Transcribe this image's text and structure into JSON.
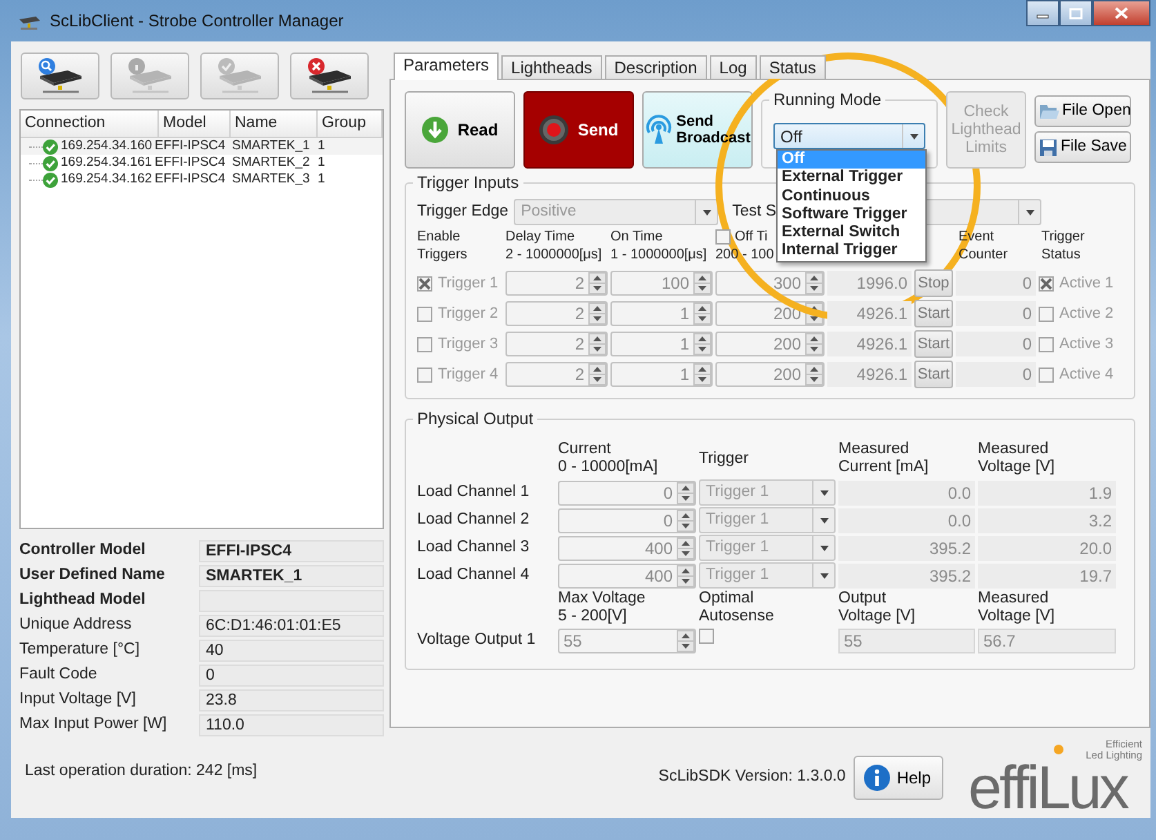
{
  "window": {
    "title": "ScLibClient - Strobe Controller Manager"
  },
  "connection_toolbar": [
    {
      "kind": "search",
      "disabled": false
    },
    {
      "kind": "info",
      "disabled": true
    },
    {
      "kind": "check",
      "disabled": true
    },
    {
      "kind": "remove",
      "disabled": false
    }
  ],
  "connections": {
    "columns": [
      "Connection",
      "Model",
      "Name",
      "Group"
    ],
    "rows": [
      {
        "connection": "169.254.34.160",
        "model": "EFFI-IPSC4",
        "name": "SMARTEK_1",
        "group": "1"
      },
      {
        "connection": "169.254.34.161",
        "model": "EFFI-IPSC4",
        "name": "SMARTEK_2",
        "group": "1"
      },
      {
        "connection": "169.254.34.162",
        "model": "EFFI-IPSC4",
        "name": "SMARTEK_3",
        "group": "1"
      }
    ]
  },
  "device_info": [
    {
      "label": "Controller Model",
      "value": "EFFI-IPSC4",
      "bold": true
    },
    {
      "label": "User Defined Name",
      "value": "SMARTEK_1",
      "bold": true
    },
    {
      "label": "Lighthead Model",
      "bold": true
    },
    {
      "label": "Unique Address",
      "value": "6C:D1:46:01:01:E5",
      "bold": false
    },
    {
      "label": "Temperature [°C]",
      "value": "40",
      "bold": false
    },
    {
      "label": "Fault Code",
      "value": "0",
      "bold": false
    },
    {
      "label": "Input Voltage [V]",
      "value": "23.8",
      "bold": false
    },
    {
      "label": "Max Input Power [W]",
      "value": "110.0",
      "bold": false
    }
  ],
  "status_text": "Last operation duration:  242 [ms]",
  "tabs": [
    {
      "label": "Parameters",
      "selected": true
    },
    {
      "label": "Lightheads",
      "selected": false
    },
    {
      "label": "Description",
      "selected": false
    },
    {
      "label": "Log",
      "selected": false
    },
    {
      "label": "Status",
      "selected": false
    }
  ],
  "actions": [
    {
      "kind": "read",
      "label": "Read"
    },
    {
      "kind": "send",
      "label": "Send"
    },
    {
      "kind": "broadcast",
      "label": "Send Broadcast"
    }
  ],
  "running_mode": {
    "title": "Running Mode",
    "value": "Off",
    "expanded": true,
    "options": [
      {
        "label": "Off",
        "selected": true
      },
      {
        "label": "External Trigger",
        "selected": false
      },
      {
        "label": "Continuous",
        "selected": false
      },
      {
        "label": "Software Trigger",
        "selected": false
      },
      {
        "label": "External Switch",
        "selected": false
      },
      {
        "label": "Internal Trigger",
        "selected": false
      }
    ]
  },
  "check_limits": {
    "label": "Check Lighthead Limits",
    "disabled": true
  },
  "file_buttons": [
    {
      "kind": "open",
      "label": "File Open"
    },
    {
      "kind": "save",
      "label": "File Save"
    }
  ],
  "trigger_inputs": {
    "title": "Trigger Inputs",
    "edge": {
      "label": "Trigger Edge",
      "value": "Positive"
    },
    "test_label": "Test S",
    "headers": [
      {
        "lines": [
          "Enable",
          "Triggers"
        ]
      },
      {
        "lines": [
          "Delay Time",
          "2 - 1000000[μs]"
        ]
      },
      {
        "lines": [
          "On Time",
          "1 - 1000000[μs]"
        ]
      },
      {
        "lines": [
          "Off Ti",
          "200 - 100"
        ],
        "checked": false
      },
      {
        "lines": [
          "Event",
          "Counter"
        ]
      },
      {
        "lines": [
          "Trigger",
          "Status"
        ]
      }
    ],
    "rows": [
      {
        "label": "Trigger 1",
        "enabled": true,
        "delay": "2",
        "on_time": "100",
        "off_time": "300",
        "frequency": "1996.0",
        "action": "Stop",
        "counter": "0",
        "status": "Active 1",
        "active": true
      },
      {
        "label": "Trigger 2",
        "enabled": false,
        "delay": "2",
        "on_time": "1",
        "off_time": "200",
        "frequency": "4926.1",
        "action": "Start",
        "counter": "0",
        "status": "Active 2",
        "active": false
      },
      {
        "label": "Trigger 3",
        "enabled": false,
        "delay": "2",
        "on_time": "1",
        "off_time": "200",
        "frequency": "4926.1",
        "action": "Start",
        "counter": "0",
        "status": "Active 3",
        "active": false
      },
      {
        "label": "Trigger 4",
        "enabled": false,
        "delay": "2",
        "on_time": "1",
        "off_time": "200",
        "frequency": "4926.1",
        "action": "Start",
        "counter": "0",
        "status": "Active 4",
        "active": false
      }
    ]
  },
  "physical_output": {
    "title": "Physical Output",
    "headers": [
      {
        "lines": [
          "Current",
          "0 - 10000[mA]"
        ]
      },
      {
        "lines": [
          "Trigger"
        ]
      },
      {
        "lines": [
          "Measured",
          "Current [mA]"
        ]
      },
      {
        "lines": [
          "Measured",
          "Voltage [V]"
        ]
      }
    ],
    "channels": [
      {
        "label": "Load Channel 1",
        "current": "0",
        "trigger": "Trigger 1",
        "measured_current": "0.0",
        "measured_voltage": "1.9"
      },
      {
        "label": "Load Channel 2",
        "current": "0",
        "trigger": "Trigger 1",
        "measured_current": "0.0",
        "measured_voltage": "3.2"
      },
      {
        "label": "Load Channel 3",
        "current": "400",
        "trigger": "Trigger 1",
        "measured_current": "395.2",
        "measured_voltage": "20.0"
      },
      {
        "label": "Load Channel 4",
        "current": "400",
        "trigger": "Trigger 1",
        "measured_current": "395.2",
        "measured_voltage": "19.7"
      }
    ],
    "voltage_headers": [
      {
        "lines": [
          "Max Voltage",
          "5 - 200[V]"
        ]
      },
      {
        "lines": [
          "Optimal",
          "Autosense"
        ]
      },
      {
        "lines": [
          "Output",
          "Voltage [V]"
        ]
      },
      {
        "lines": [
          "Measured",
          "Voltage [V]"
        ]
      }
    ],
    "voltage_output": {
      "label": "Voltage Output 1",
      "max_voltage": "55",
      "autosense": false,
      "output_voltage": "55",
      "measured_voltage": "56.7"
    }
  },
  "footer": {
    "version": "ScLibSDK Version:  1.3.0.0",
    "help": "Help"
  },
  "logo": {
    "wordmark": "effiLux",
    "tagline": [
      "Efficient",
      "Led Lighting"
    ]
  }
}
